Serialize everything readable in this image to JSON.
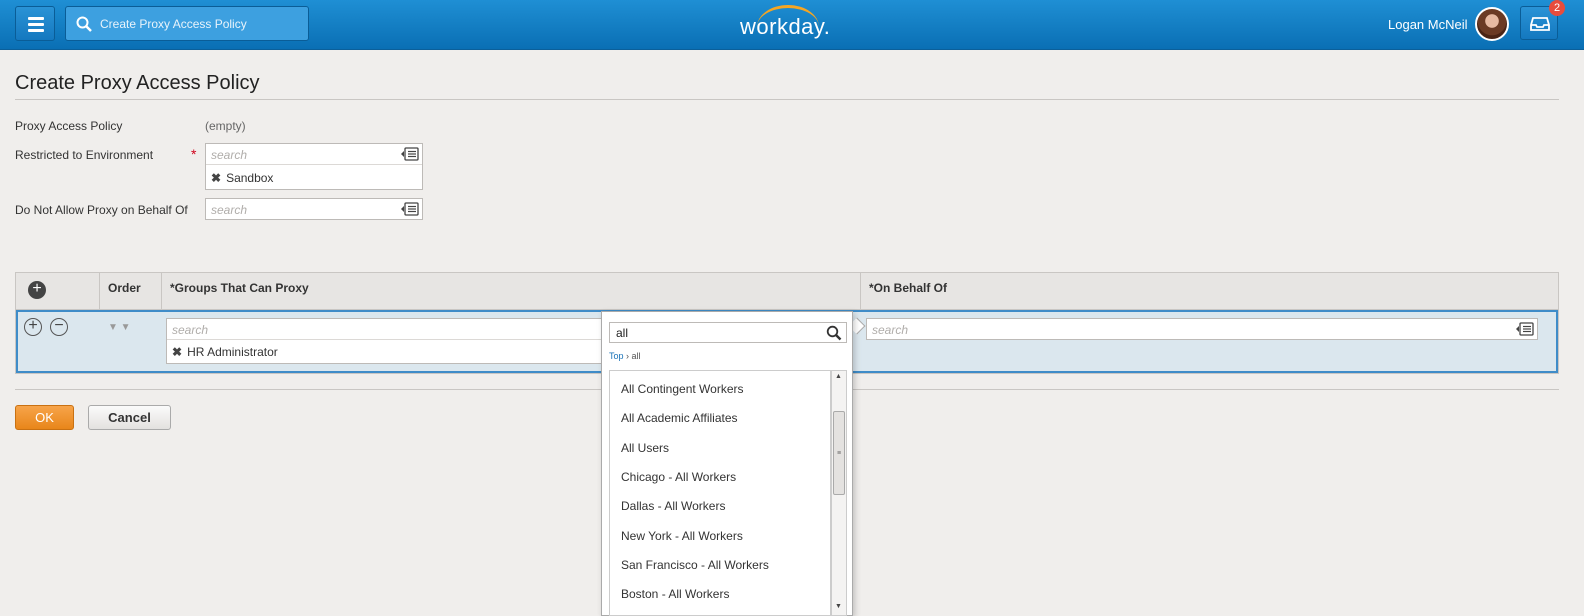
{
  "header": {
    "search_text": "Create Proxy Access Policy",
    "logo_text": "workday.",
    "user_name": "Logan McNeil",
    "inbox_count": "2"
  },
  "page": {
    "title": "Create Proxy Access Policy"
  },
  "form": {
    "policy_label": "Proxy Access Policy",
    "policy_value": "(empty)",
    "environment_label": "Restricted to Environment",
    "required_marker": "*",
    "environment_placeholder": "search",
    "environment_selected": "Sandbox",
    "not_allow_label": "Do Not Allow Proxy on Behalf Of",
    "not_allow_placeholder": "search",
    "remove_glyph": "✖"
  },
  "grid": {
    "headers": {
      "order": "Order",
      "groups": "*Groups That Can Proxy",
      "on_behalf": "*On Behalf Of"
    },
    "row": {
      "groups_placeholder": "search",
      "groups_selected": "HR Administrator",
      "on_behalf_placeholder": "search"
    }
  },
  "dropdown": {
    "query": "all",
    "breadcrumb_top": "Top",
    "breadcrumb_sep": "›",
    "breadcrumb_current": "all",
    "items": [
      "All Contingent Workers",
      "All Academic Affiliates",
      "All Users",
      "Chicago - All Workers",
      "Dallas - All Workers",
      "New York - All Workers",
      "San Francisco - All Workers",
      "Boston - All Workers"
    ]
  },
  "buttons": {
    "ok": "OK",
    "cancel": "Cancel"
  },
  "icons": {
    "menu": "hamburger-icon",
    "search": "search-icon",
    "inbox": "inbox-icon",
    "list": "list-icon",
    "add": "plus-circle-icon",
    "remove": "minus-circle-icon"
  },
  "colors": {
    "header_blue": "#1478bf",
    "ok_orange": "#e8861a",
    "required_red": "#d0021b",
    "row_highlight": "#3f8cc8"
  }
}
